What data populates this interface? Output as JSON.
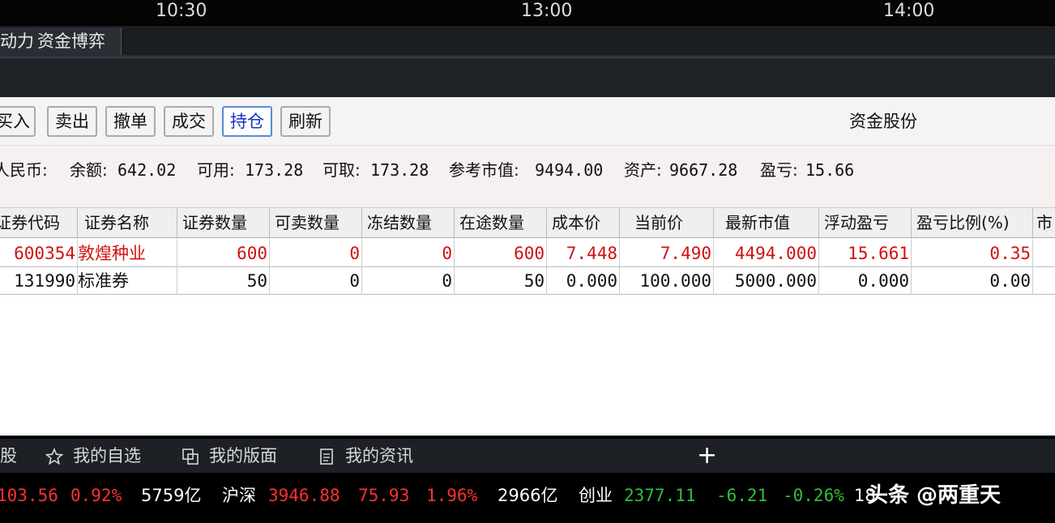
{
  "time_axis": [
    "10:30",
    "13:00",
    "14:00"
  ],
  "tabs": [
    "动力",
    "资金博弈"
  ],
  "toolbar": {
    "buttons": [
      "买入",
      "卖出",
      "撤单",
      "成交",
      "持仓",
      "刷新"
    ],
    "active": "持仓",
    "fund_label": "资金股份"
  },
  "summary": {
    "currency": "人民币:",
    "balance_label": "余额:",
    "balance": "642.02",
    "available_label": "可用:",
    "available": "173.28",
    "withdrawable_label": "可取:",
    "withdrawable": "173.28",
    "ref_value_label": "参考市值:",
    "ref_value": "9494.00",
    "assets_label": "资产:",
    "assets": "9667.28",
    "pnl_label": "盈亏:",
    "pnl": "15.66"
  },
  "table": {
    "headers": [
      "证券代码",
      "证券名称",
      "证券数量",
      "可卖数量",
      "冻结数量",
      "在途数量",
      "成本价",
      "当前价",
      "最新市值",
      "浮动盈亏",
      "盈亏比例(%)",
      "市"
    ],
    "rows": [
      [
        "600354",
        "敦煌种业",
        "600",
        "0",
        "0",
        "600",
        "7.448",
        "7.490",
        "4494.000",
        "15.661",
        "0.35"
      ],
      [
        "131990",
        "标准券",
        "50",
        "0",
        "0",
        "50",
        "0.000",
        "100.000",
        "5000.000",
        "0.000",
        "0.00"
      ]
    ]
  },
  "bottom_nav": {
    "items": [
      "股",
      "我的自选",
      "我的版面",
      "我的资讯"
    ],
    "plus": "+"
  },
  "ticker": {
    "a_value": "103.56",
    "a_pct": "0.92%",
    "a_vol": "5759亿",
    "b_name": "沪深",
    "b_value": "3946.88",
    "b_change": "75.93",
    "b_pct": "1.96%",
    "b_vol": "2966亿",
    "c_name": "创业",
    "c_value": "2377.11",
    "c_change": "-6.21",
    "c_pct": "-0.26%",
    "d_value": "18"
  },
  "watermark": "头条 @两重天",
  "colors": {
    "up": "#d01010",
    "down": "#2fbf3a",
    "active_tab": "#1530c8"
  }
}
